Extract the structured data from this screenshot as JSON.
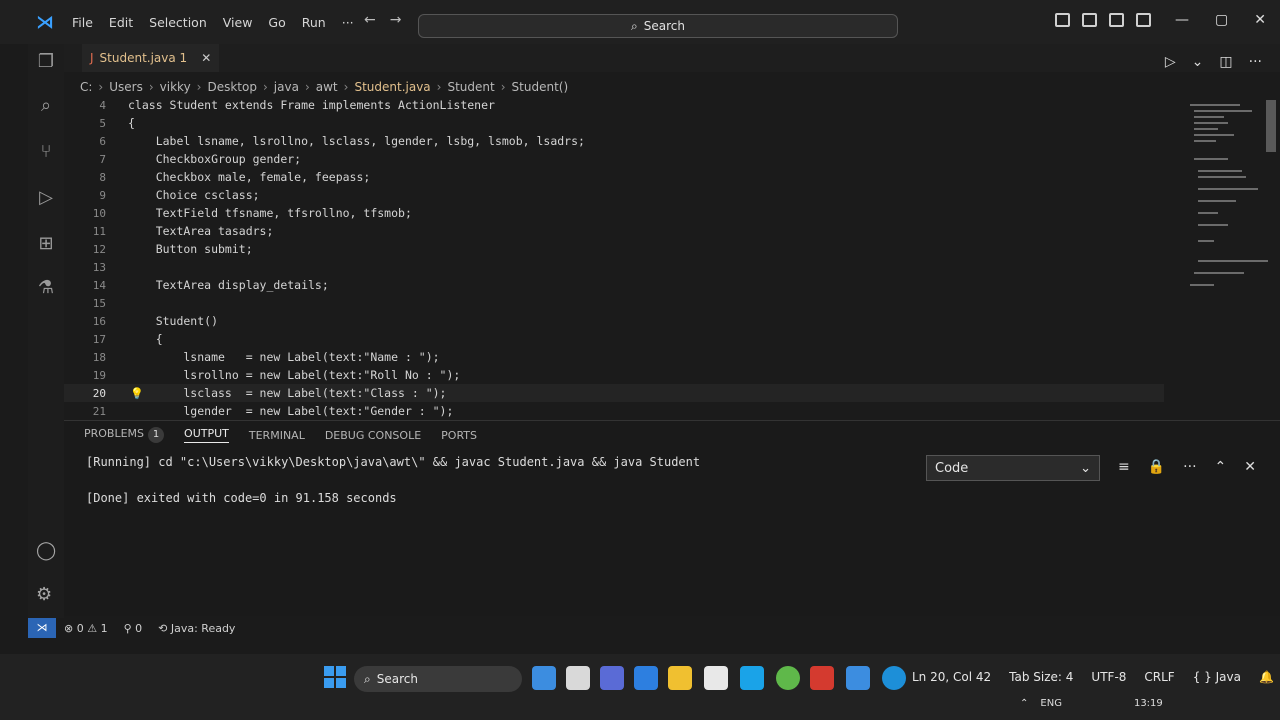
{
  "menu": [
    "File",
    "Edit",
    "Selection",
    "View",
    "Go",
    "Run",
    "···"
  ],
  "search": {
    "label": "Search"
  },
  "tab": {
    "name": "Student.java 1"
  },
  "breadcrumb": [
    "C:",
    "Users",
    "vikky",
    "Desktop",
    "java",
    "awt",
    "Student.java",
    "Student",
    "Student()"
  ],
  "code": [
    {
      "n": "4",
      "t": "class Student extends Frame implements ActionListener"
    },
    {
      "n": "5",
      "t": "{"
    },
    {
      "n": "6",
      "t": "    Label lsname, lsrollno, lsclass, lgender, lsbg, lsmob, lsadrs;"
    },
    {
      "n": "7",
      "t": "    CheckboxGroup gender;"
    },
    {
      "n": "8",
      "t": "    Checkbox male, female, feepass;"
    },
    {
      "n": "9",
      "t": "    Choice csclass;"
    },
    {
      "n": "10",
      "t": "    TextField tfsname, tfsrollno, tfsmob;"
    },
    {
      "n": "11",
      "t": "    TextArea tasadrs;"
    },
    {
      "n": "12",
      "t": "    Button submit;"
    },
    {
      "n": "13",
      "t": ""
    },
    {
      "n": "14",
      "t": "    TextArea display_details;"
    },
    {
      "n": "15",
      "t": ""
    },
    {
      "n": "16",
      "t": "    Student()"
    },
    {
      "n": "17",
      "t": "    {"
    },
    {
      "n": "18",
      "t": "        lsname   = new Label(text:\"Name : \");"
    },
    {
      "n": "19",
      "t": "        lsrollno = new Label(text:\"Roll No : \");"
    },
    {
      "n": "20",
      "t": "        lsclass  = new Label(text:\"Class : \");"
    },
    {
      "n": "21",
      "t": "        lgender  = new Label(text:\"Gender : \");"
    }
  ],
  "panel": {
    "tabs": [
      "PROBLEMS",
      "OUTPUT",
      "TERMINAL",
      "DEBUG CONSOLE",
      "PORTS"
    ],
    "problems_count": "1",
    "dropdown": "Code",
    "output": [
      "[Running] cd \"c:\\Users\\vikky\\Desktop\\java\\awt\\\" && javac Student.java && java Student",
      "[Done] exited with code=0 in 91.158 seconds"
    ]
  },
  "status": {
    "errors": "0",
    "warnings": "1",
    "ports": "0",
    "java": "Java: Ready",
    "position": "Ln 20, Col 42",
    "tabsize": "Tab Size: 4",
    "encoding": "UTF-8",
    "eol": "CRLF",
    "lang": "Java"
  },
  "taskbar": {
    "search": "Search",
    "lang": "ENG",
    "time": "13:19"
  }
}
